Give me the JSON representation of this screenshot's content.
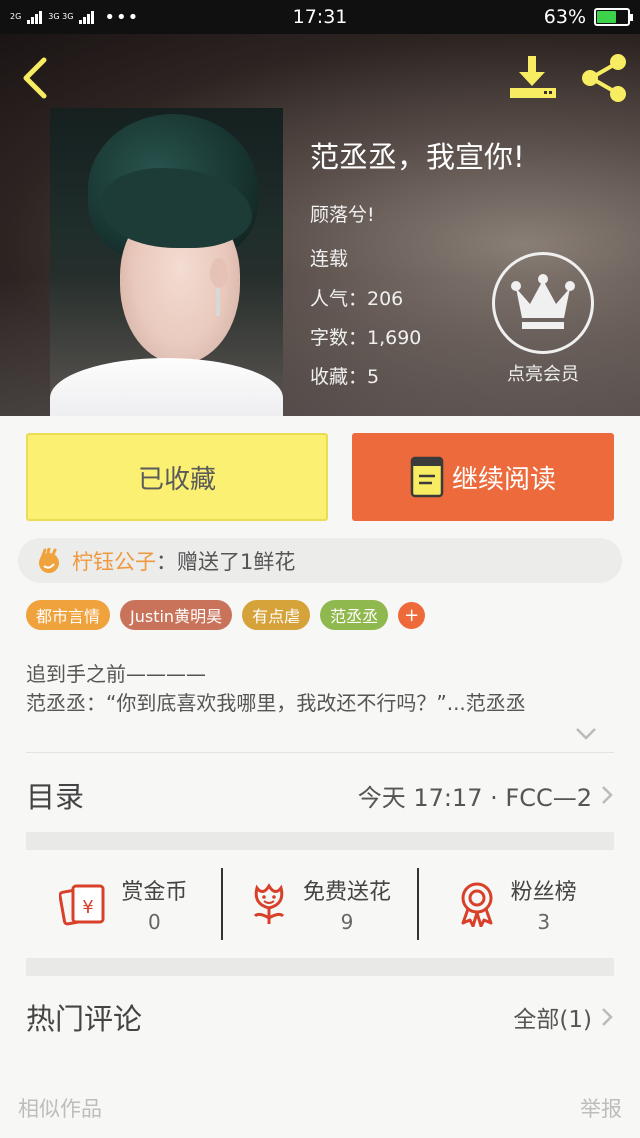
{
  "status_bar": {
    "sim1": "2G",
    "sim2": "3G 3G",
    "dots": "•••",
    "time": "17:31",
    "battery_pct": "63%",
    "battery_level": 0.63
  },
  "header": {
    "title": "范丞丞，我宣你!",
    "author": "顾落兮!",
    "status": "连载",
    "popularity": "人气：206",
    "word_count": "字数：1,690",
    "favorites": "收藏：5",
    "member_label": "点亮会员",
    "icons": [
      "back-icon",
      "download-icon",
      "share-icon",
      "crown-icon"
    ]
  },
  "actions": {
    "favorited_label": "已收藏",
    "continue_label": "继续阅读"
  },
  "gift": {
    "user": "柠钰公子",
    "message": "：赠送了1鲜花"
  },
  "tags": [
    {
      "label": "都市言情",
      "color": "#f0a23c"
    },
    {
      "label": "Justin黄明昊",
      "color": "#c9735a"
    },
    {
      "label": "有点虐",
      "color": "#d6a23a"
    },
    {
      "label": "范丞丞",
      "color": "#8fb84e"
    }
  ],
  "tag_add": "+",
  "synopsis": {
    "line1": "追到手之前————",
    "line2": "范丞丞：“你到底喜欢我哪里，我改还不行吗？”...范丞丞"
  },
  "toc": {
    "label": "目录",
    "latest": "今天 17:17 · FCC—2"
  },
  "stats": [
    {
      "name": "赏金币",
      "value": "0",
      "icon": "red-envelope-icon"
    },
    {
      "name": "免费送花",
      "value": "9",
      "icon": "flower-icon"
    },
    {
      "name": "粉丝榜",
      "value": "3",
      "icon": "medal-icon"
    }
  ],
  "comments": {
    "label": "热门评论",
    "all": "全部(1)"
  },
  "footer": {
    "similar": "相似作品",
    "report": "举报"
  },
  "colors": {
    "accent_orange": "#ec6a3c",
    "favorite_yellow": "#fbf072",
    "icon_yellow": "#f7ec62",
    "stat_icon_red": "#d8402a"
  }
}
